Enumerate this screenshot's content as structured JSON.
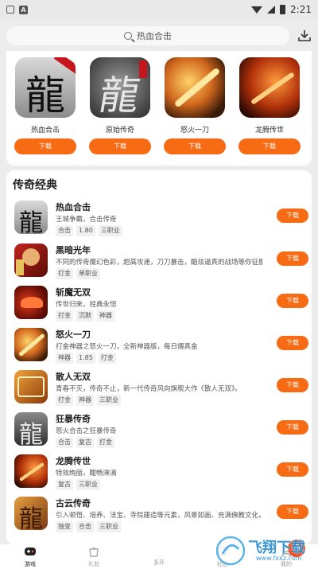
{
  "status_bar": {
    "time": "2:21",
    "badge": "A"
  },
  "search": {
    "placeholder": "热血合击"
  },
  "top_games": [
    {
      "name": "热血合击",
      "download": "下载",
      "icon_text": "龍"
    },
    {
      "name": "原始传奇",
      "download": "下载",
      "icon_text": "龍"
    },
    {
      "name": "怒火一刀",
      "download": "下载",
      "icon_text": ""
    },
    {
      "name": "龙腾传世",
      "download": "下载",
      "icon_text": ""
    }
  ],
  "section": {
    "title": "传奇经典",
    "games": [
      {
        "title": "热血合击",
        "desc": "王城争霸，合击传奇",
        "tags": [
          "合击",
          "1.80",
          "三职业"
        ],
        "download": "下载"
      },
      {
        "title": "黑暗光年",
        "desc": "不同的传奇魔幻色彩，超高攻速，刀刀暴击，酷炫逼真的战场等你征服",
        "tags": [
          "打金",
          "单职业"
        ],
        "download": "下载"
      },
      {
        "title": "斩魔无双",
        "desc": "传世归来，经典永恒",
        "tags": [
          "打金",
          "沉默",
          "神器"
        ],
        "download": "下载"
      },
      {
        "title": "怒火一刀",
        "desc": "打金神器之怒火一刀，全新神器版，每日煨真金",
        "tags": [
          "神器",
          "1.85",
          "打金"
        ],
        "download": "下载"
      },
      {
        "title": "散人无双",
        "desc": "青春不灭，传奇不止，新一代传奇风向旗舰大作《散人无双》。",
        "tags": [
          "打金",
          "神器",
          "三职业"
        ],
        "download": "下载"
      },
      {
        "title": "狂暴传奇",
        "desc": "怒火合击之狂暴传奇",
        "tags": [
          "合击",
          "复古",
          "打金"
        ],
        "download": "下载"
      },
      {
        "title": "龙腾传世",
        "desc": "特效绚丽，酣畅淋漓",
        "tags": [
          "复古",
          "三职业"
        ],
        "download": "下载"
      },
      {
        "title": "古云传奇",
        "desc": "引入顿悟、培养、法宝、寺院建造等元素，风景如画、充满佛教文化，为",
        "tags": [
          "独变",
          "合击",
          "三职业"
        ],
        "download": "下载"
      }
    ]
  },
  "tabbar": {
    "tabs": [
      {
        "label": "游戏"
      },
      {
        "label": "礼包"
      },
      {
        "label": "多开"
      },
      {
        "label": "社区"
      },
      {
        "label": "我的"
      }
    ]
  },
  "watermark": {
    "text": "飞翔下载",
    "url": "www.fxxz.com"
  },
  "colors": {
    "accent": "#f66b14",
    "background": "#ececec"
  }
}
